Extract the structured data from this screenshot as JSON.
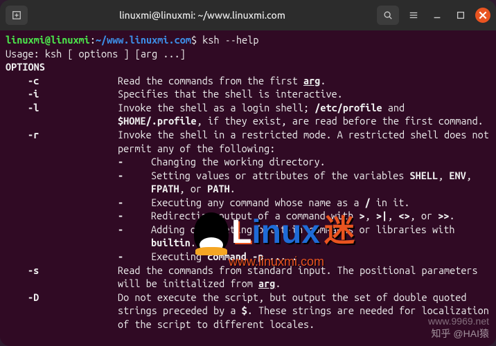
{
  "titlebar": {
    "title": "linuxmi@linuxmi: ~/www.linuxmi.com"
  },
  "prompt": {
    "user": "linuxmi@linuxmi",
    "colon": ":",
    "path": "~/www.linuxmi.com",
    "dollar": "$",
    "command": "ksh --help"
  },
  "output": {
    "usage": "Usage: ksh [ options ] [arg ...]",
    "options_header": "OPTIONS",
    "options": [
      {
        "flag": "-c",
        "desc_parts": [
          "Read the commands from the first ",
          {
            "b": true,
            "u": true,
            "t": "arg"
          },
          "."
        ]
      },
      {
        "flag": "-i",
        "desc_parts": [
          "Specifies that the shell is interactive."
        ]
      },
      {
        "flag": "-l",
        "desc_parts": [
          "Invoke the shell as a login shell; ",
          {
            "b": true,
            "t": "/etc/profile"
          },
          " and ",
          {
            "b": true,
            "t": "$HOME/.profile"
          },
          ", if they exist, are read before the first command."
        ]
      },
      {
        "flag": "-r",
        "desc_parts": [
          "Invoke the shell in a restricted mode. A restricted shell does not permit any of the following:"
        ],
        "subs": [
          [
            "Changing the working directory."
          ],
          [
            "Setting values or attributes of the variables ",
            {
              "b": true,
              "t": "SHELL"
            },
            ", ",
            {
              "b": true,
              "t": "ENV"
            },
            ", ",
            {
              "b": true,
              "t": "FPATH"
            },
            ", or ",
            {
              "b": true,
              "t": "PATH"
            },
            "."
          ],
          [
            "Executing any command whose name as a ",
            {
              "b": true,
              "t": "/"
            },
            " in it."
          ],
          [
            "Redirecting output of a command with ",
            {
              "b": true,
              "t": ">"
            },
            ", ",
            {
              "b": true,
              "t": ">|"
            },
            ", ",
            {
              "b": true,
              "t": "<>"
            },
            ", or ",
            {
              "b": true,
              "t": ">>"
            },
            "."
          ],
          [
            "Adding or deleting built-in commands or libraries with ",
            {
              "b": true,
              "t": "builtin"
            },
            "."
          ],
          [
            "Executing ",
            {
              "b": true,
              "t": "command -p"
            },
            " ",
            {
              "b": true,
              "t": "..."
            },
            " ."
          ]
        ]
      },
      {
        "flag": "-s",
        "desc_parts": [
          "Read the commands from standard input. The positional parameters will be initialized from ",
          {
            "b": true,
            "u": true,
            "t": "arg"
          },
          "."
        ]
      },
      {
        "flag": "-D",
        "desc_parts": [
          "Do not execute the script, but output the set of double quoted strings preceded by a ",
          {
            "b": true,
            "t": "$"
          },
          ". These strings are needed for localization of the script to different locales."
        ]
      }
    ]
  },
  "watermark": {
    "l": "L",
    "inux": "inux",
    "mi": "迷",
    "sub": "www.linuxmi.com"
  },
  "corner": {
    "zhihu": "知乎 @HAI猿",
    "site": "www.9969.net"
  }
}
